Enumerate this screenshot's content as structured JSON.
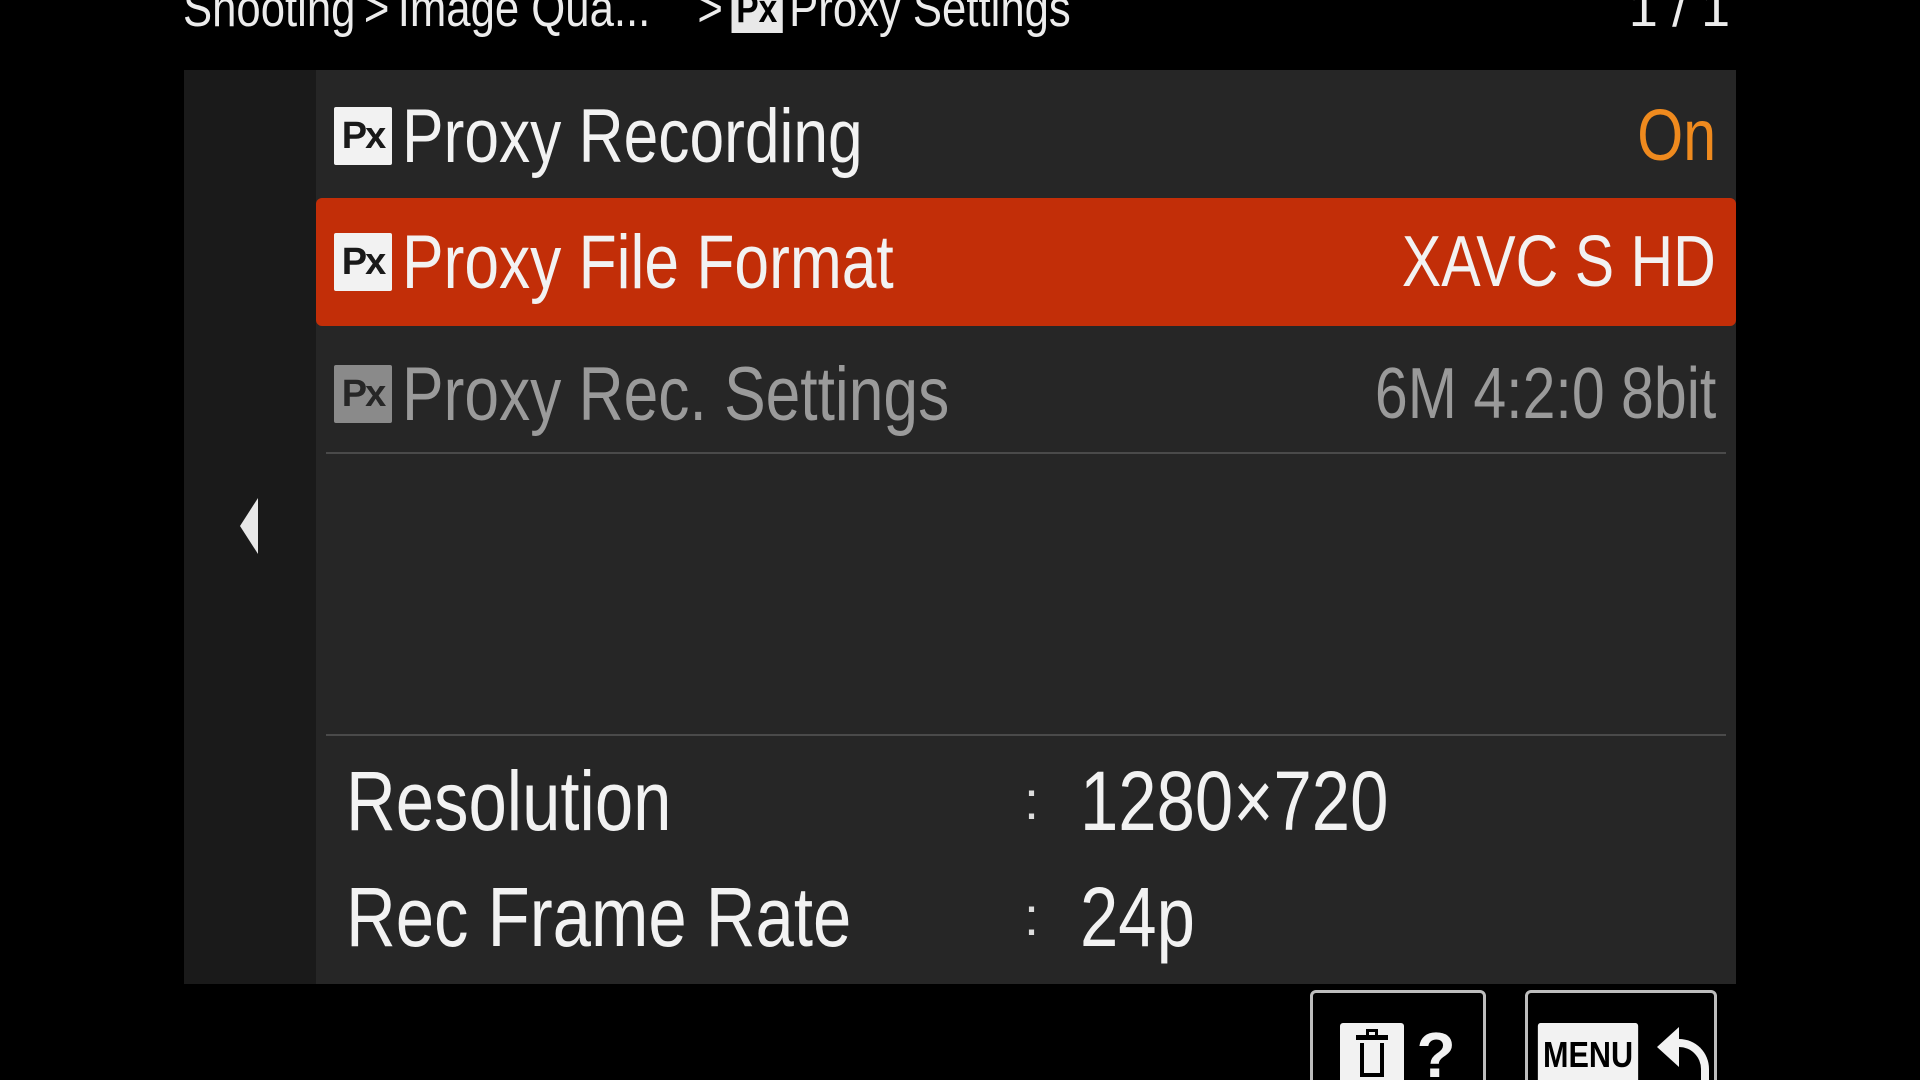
{
  "header": {
    "breadcrumb": [
      "Shooting",
      "Image Qua...",
      "Proxy Settings"
    ],
    "separator": ">",
    "section_badge": "Px",
    "page_indicator": "1 / 1"
  },
  "menu": {
    "items": [
      {
        "badge": "Px",
        "label": "Proxy Recording",
        "value": "On",
        "state": "normal"
      },
      {
        "badge": "Px",
        "label": "Proxy File Format",
        "value": "XAVC S HD",
        "state": "selected"
      },
      {
        "badge": "Px",
        "label": "Proxy Rec. Settings",
        "value": "6M 4:2:0 8bit",
        "state": "disabled"
      }
    ]
  },
  "info": [
    {
      "label": "Resolution",
      "separator": ":",
      "value": "1280×720"
    },
    {
      "label": "Rec Frame Rate",
      "separator": ":",
      "value": "24p"
    }
  ],
  "softkeys": {
    "delete_help": {
      "icon": "trash-icon",
      "glyph": "?"
    },
    "menu_back": {
      "badge": "MENU",
      "icon": "return-icon"
    }
  },
  "colors": {
    "selected_row": "#c22e08",
    "value_on": "#ef8a1e",
    "panel": "#262626",
    "rail": "#1a1a1a"
  }
}
